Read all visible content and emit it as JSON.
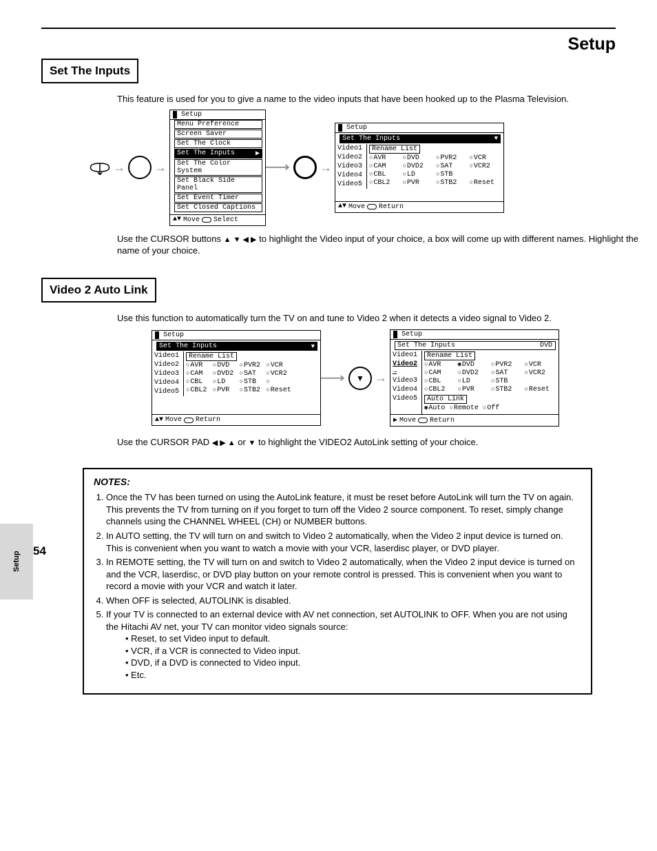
{
  "header": {
    "top_right": "Setup",
    "set_inputs": "Set The Inputs",
    "body_line": "This  feature  is  used  for  you  to  give  a  name  to  the  video  inputs  that  have  been  hooked  up  to  the Plasma Television."
  },
  "section2": {
    "title": "Video 2 Auto Link",
    "body_line": "Use this function to automatically turn the TV on and tune to Video 2 when it detects a video signal to Video 2."
  },
  "steps": {
    "s1_pre": "Use the CURSOR buttons ",
    "s1_glyphs": "▲ ▼ ◀ ▶",
    "s1_post": "  to highlight the Video input of your choice, a box will come up with different names. Highlight the name of your choice.",
    "p1_pre": "Use the CURSOR PAD ",
    "p1_glyphs": "◀ ▶ ▲",
    "p1_mid": " or ",
    "p1_glyph2": "▼",
    "p1_post": " to highlight the VIDEO2 AutoLink setting of your choice."
  },
  "osd_setup_title": "Setup",
  "osd_subtitle": "Set The Inputs",
  "osd_menu_items": [
    "Menu Preference",
    "Screen Saver",
    "Set The Clock",
    "Set The Inputs",
    "Set The Color System",
    "Set Black Side Panel",
    "Set Event Timer",
    "Set Closed Captions"
  ],
  "osd_foot_move": "Move",
  "osd_foot_select": "Select",
  "osd_foot_return": "Return",
  "video_labels": [
    "Video1",
    "Video2",
    "Video3",
    "Video4",
    "Video5"
  ],
  "rename_list": "Rename List",
  "auto_link": "Auto Link",
  "autolink_opts": [
    "Auto",
    "Remote",
    "Off"
  ],
  "rename_opts_row": [
    [
      "AVR",
      "DVD",
      "PVR2",
      "VCR"
    ],
    [
      "CAM",
      "DVD2",
      "SAT",
      "VCR2"
    ],
    [
      "CBL",
      "LD",
      "STB",
      ""
    ],
    [
      "CBL2",
      "PVR",
      "STB2",
      "Reset"
    ]
  ],
  "current_label_dvd": "DVD",
  "page_number": "54",
  "side_tab": "Setup",
  "notes": {
    "label": "NOTES:",
    "n1": "Once the TV has been turned on using the AutoLink feature, it must be reset before AutoLink will turn the TV on again. This prevents the TV from turning on  if  you  forget  to  turn  off  the  Video  2  source  component.  To  reset,  simply  change  channels  using  the  CHANNEL  WHEEL  (CH) or NUMBER buttons.",
    "n2": "In AUTO setting, the TV will turn on and switch to Video 2 automatically, when the Video 2 input device is turned on.  This is  convenient when you want to watch a movie with your VCR, laserdisc player, or DVD player.",
    "n3": "In REMOTE setting, the TV will turn on and switch to Video 2 automatically, when the Video 2 input device is turned on and the VCR, laserdisc, or DVD play button on your remote control is pressed.  This is convenient when you want to record a movie with your VCR and watch it later.",
    "n4": "When OFF is selected, AUTOLINK is disabled.",
    "n5": "If your TV is connected to an external device with AV net connection, set AUTOLINK to OFF. When you are not using the Hitachi AV net, your TV can monitor video signals source:",
    "n5a": "• Reset, to set Video input to default.",
    "n5b": "• VCR, if  a VCR is connected to Video input.",
    "n5c": "• DVD, if a DVD is connected to Video input.",
    "n5d": "• Etc."
  }
}
